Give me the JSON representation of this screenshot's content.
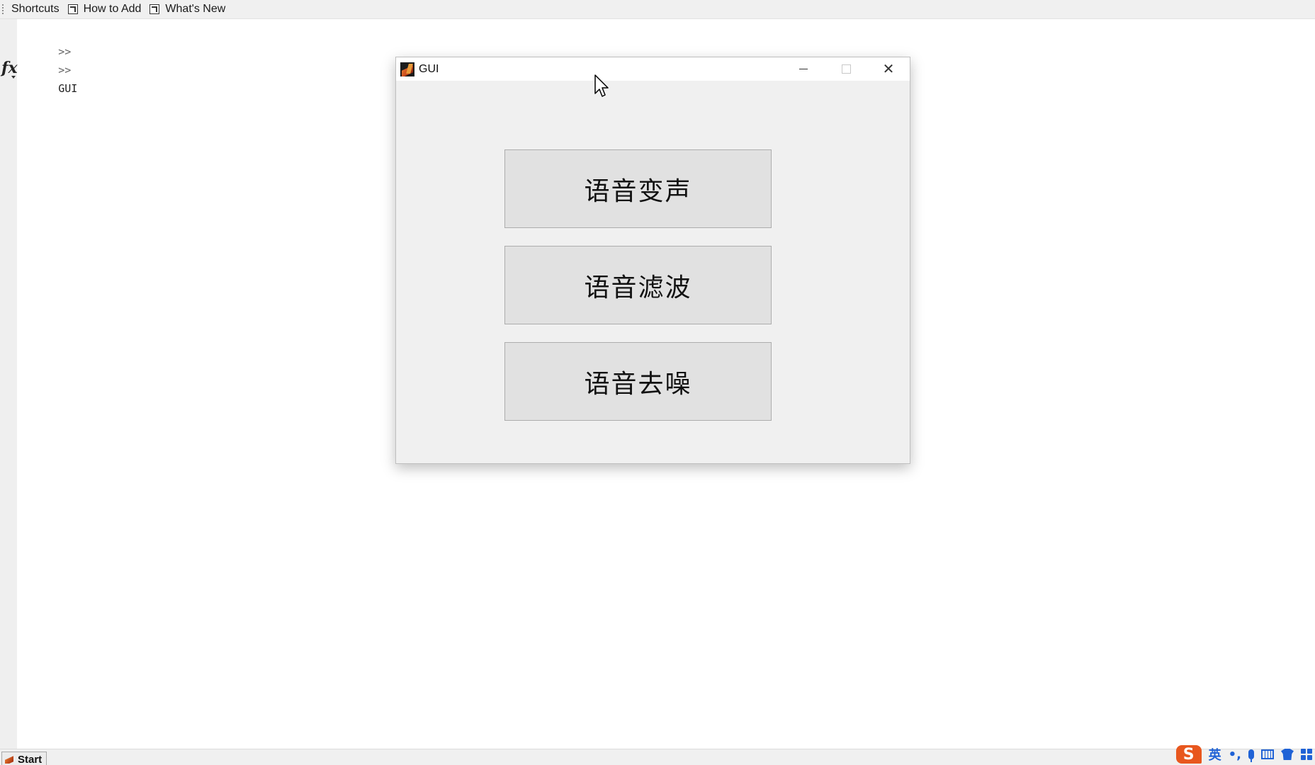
{
  "shortcuts_bar": {
    "items": [
      {
        "label": "Shortcuts"
      },
      {
        "label": "How to Add"
      },
      {
        "label": "What's New"
      }
    ]
  },
  "command_window": {
    "prompt": ">>",
    "lines": [
      {
        "text": "GUI"
      },
      {
        "text": ""
      }
    ]
  },
  "gui_window": {
    "title": "GUI",
    "buttons": [
      {
        "label": "语音变声"
      },
      {
        "label": "语音滤波"
      },
      {
        "label": "语音去噪"
      }
    ]
  },
  "taskbar": {
    "start_label": "Start"
  },
  "ime": {
    "logo_text": "S",
    "mode_label": "英",
    "punct_label": "•,"
  },
  "colors": {
    "ime_accent": "#1f62d6",
    "ime_brand": "#e8571e"
  }
}
